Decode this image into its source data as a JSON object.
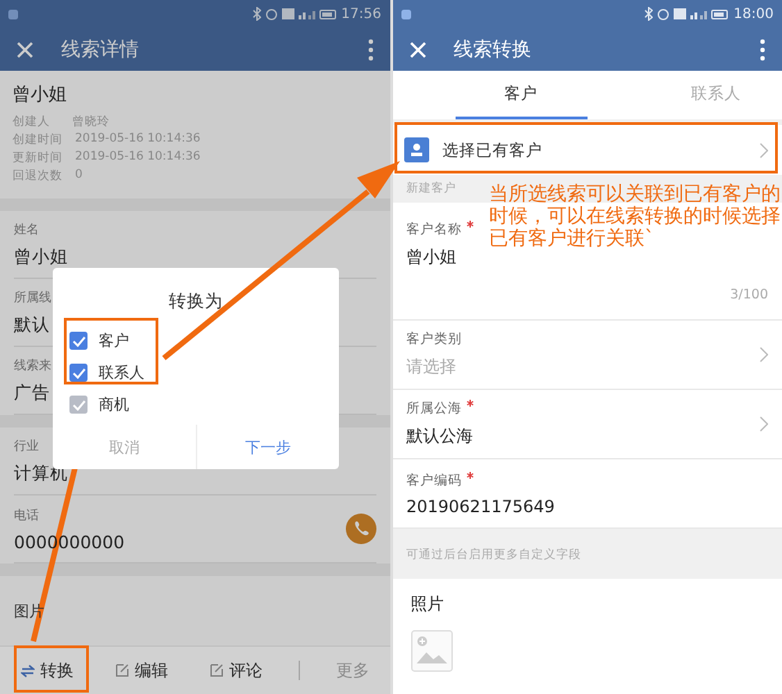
{
  "left_screen": {
    "status_time": "17:56",
    "title": "线索详情",
    "lead": {
      "name": "曾小姐",
      "meta": [
        {
          "label": "创建人",
          "value": "曾晓玲"
        },
        {
          "label": "创建时间",
          "value": "2019-05-16 10:14:36"
        },
        {
          "label": "更新时间",
          "value": "2019-05-16 10:14:36"
        },
        {
          "label": "回退次数",
          "value": "0"
        }
      ]
    },
    "sections": [
      [
        {
          "label": "姓名",
          "value": "曾小姐",
          "kind": "text"
        },
        {
          "label": "所属线",
          "value": "默认",
          "kind": "text"
        },
        {
          "label": "线索来",
          "value": "广告",
          "kind": "text"
        }
      ],
      [
        {
          "label": "行业",
          "value": "计算机",
          "kind": "text"
        },
        {
          "label": "电话",
          "value": "0000000000",
          "kind": "phone"
        }
      ]
    ],
    "photo_label": "图片",
    "bottom_bar": [
      {
        "label": "转换",
        "kind": "convert"
      },
      {
        "label": "编辑",
        "kind": "edit"
      },
      {
        "label": "评论",
        "kind": "edit"
      },
      {
        "label": "更多",
        "kind": "more"
      }
    ],
    "dialog": {
      "title": "转换为",
      "options": [
        {
          "label": "客户",
          "checked": true,
          "disabled": false
        },
        {
          "label": "联系人",
          "checked": true,
          "disabled": false
        },
        {
          "label": "商机",
          "checked": true,
          "disabled": true
        }
      ],
      "cancel": "取消",
      "confirm": "下一步"
    }
  },
  "right_screen": {
    "status_time": "18:00",
    "title": "线索转换",
    "tabs": [
      {
        "label": "客户",
        "selected": true
      },
      {
        "label": "联系人",
        "selected": false
      }
    ],
    "pick_existing": "选择已有客户",
    "section_label": "新建客户",
    "fields": [
      {
        "label": "客户名称",
        "required": true,
        "value": "曾小姐",
        "counter": "3/100",
        "kind": "text"
      },
      {
        "label": "客户类别",
        "required": false,
        "placeholder": "请选择",
        "kind": "select"
      },
      {
        "label": "所属公海",
        "required": true,
        "value": "默认公海",
        "kind": "select"
      },
      {
        "label": "客户编码",
        "required": true,
        "value": "20190621175649",
        "kind": "text"
      }
    ],
    "hint": "可通过后台启用更多自定义字段",
    "photo_label": "照片"
  },
  "annotation": "当所选线索可以关联到已有客户的时候，可以在线索转换的时候选择已有客户进行关联`"
}
